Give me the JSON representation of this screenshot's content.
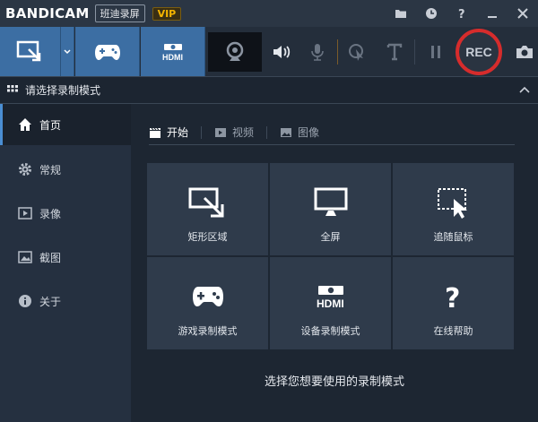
{
  "app": {
    "brand": "BANDICAM",
    "brand_cn": "班迪录屏",
    "vip": "VIP"
  },
  "toolbar": {
    "rec_label": "REC"
  },
  "section": {
    "title": "请选择录制模式"
  },
  "sidebar": {
    "items": [
      {
        "label": "首页",
        "icon": "home-icon",
        "active": true
      },
      {
        "label": "常规",
        "icon": "gear-icon"
      },
      {
        "label": "录像",
        "icon": "video-icon"
      },
      {
        "label": "截图",
        "icon": "image-icon"
      },
      {
        "label": "关于",
        "icon": "info-icon"
      }
    ]
  },
  "tabs": [
    {
      "label": "开始",
      "icon": "clapper-icon",
      "active": true
    },
    {
      "label": "视频",
      "icon": "play-icon"
    },
    {
      "label": "图像",
      "icon": "picture-icon"
    }
  ],
  "tiles": [
    {
      "label": "矩形区域",
      "icon": "rectangle-area-icon"
    },
    {
      "label": "全屏",
      "icon": "monitor-icon"
    },
    {
      "label": "追随鼠标",
      "icon": "follow-mouse-icon"
    },
    {
      "label": "游戏录制模式",
      "icon": "gamepad-icon"
    },
    {
      "label": "设备录制模式",
      "icon": "hdmi-icon"
    },
    {
      "label": "在线帮助",
      "icon": "question-icon"
    }
  ],
  "main": {
    "hint": "选择您想要使用的录制模式"
  },
  "colors": {
    "accent": "#3c6ea3",
    "rec_ring": "#d62c2c",
    "vip": "#f5b400"
  }
}
